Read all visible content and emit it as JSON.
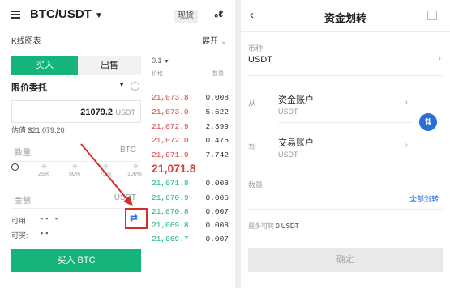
{
  "left": {
    "pair": "BTC/USDT",
    "leverage_badge": "现货",
    "kline_label": "K线图表",
    "expand_label": "展开",
    "tab_buy": "买入",
    "tab_sell": "出售",
    "order_type": "限价委托",
    "price_value": "21079.2",
    "price_unit": "USDT",
    "estimate_text": "估值 $21,079.20",
    "qty_placeholder": "数量",
    "qty_unit": "BTC",
    "slider_ticks": [
      "25%",
      "50%",
      "75%",
      "100%"
    ],
    "amount_placeholder": "金额",
    "amount_unit": "USDT",
    "avail_label": "可用",
    "avail_dots": "▪▪  ▪",
    "canbuy_label": "可买:",
    "canbuy_dots": "▪▪",
    "submit_label": "买入 BTC",
    "depth_label": "0.1",
    "col_price": "价格",
    "col_qty": "数量",
    "asks": [
      {
        "p": "21,073.8",
        "q": "0.008"
      },
      {
        "p": "21,073.0",
        "q": "5.622"
      },
      {
        "p": "21,072.9",
        "q": "2.399"
      },
      {
        "p": "21,072.0",
        "q": "0.475"
      },
      {
        "p": "21,071.9",
        "q": "7.742"
      }
    ],
    "last_price": "21,071.8",
    "bids": [
      {
        "p": "21,071.8",
        "q": "0.008"
      },
      {
        "p": "21,070.9",
        "q": "0.006"
      },
      {
        "p": "21,070.8",
        "q": "0.007"
      },
      {
        "p": "21,069.8",
        "q": "0.008"
      },
      {
        "p": "21,069.7",
        "q": "0.007"
      }
    ]
  },
  "right": {
    "title": "资金划转",
    "currency_label": "币种",
    "currency_value": "USDT",
    "from_label": "从",
    "from_account": "资金账户",
    "from_sub": "USDT",
    "to_label": "到",
    "to_account": "交易账户",
    "to_sub": "USDT",
    "qty_label": "数量",
    "transfer_all": "全部划转",
    "max_label": "最多可转",
    "max_value": "0 USDT",
    "confirm_label": "确定"
  },
  "colors": {
    "accent_green": "#14b47a",
    "ask_red": "#d23f3f",
    "annotation_red": "#d0312d"
  }
}
